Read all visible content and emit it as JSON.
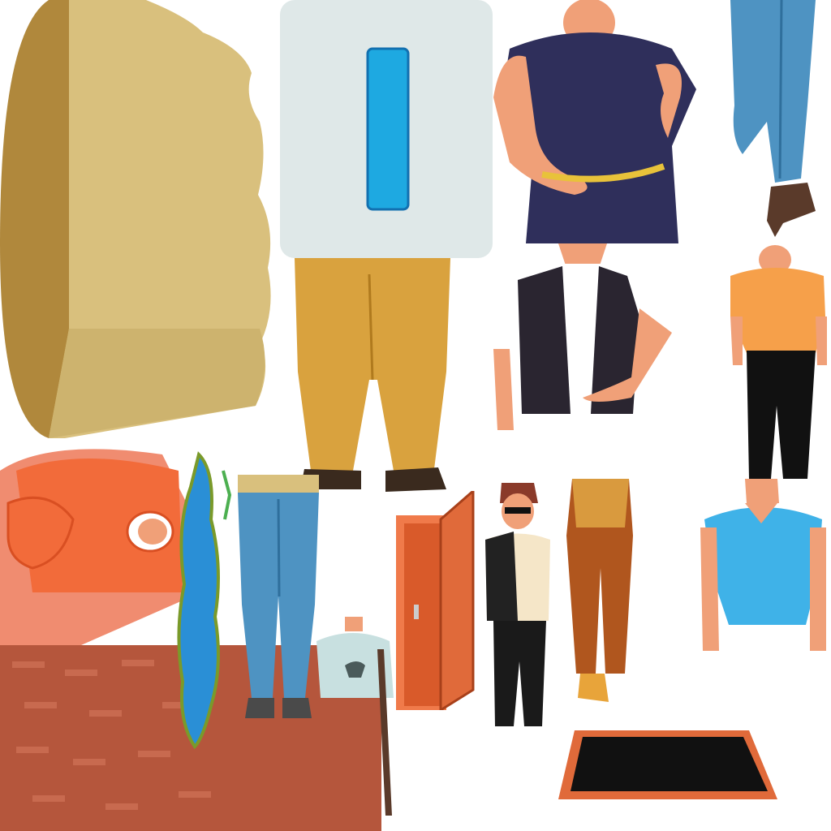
{
  "sheet": {
    "background_color": "#ffffff",
    "sprites": [
      {
        "name": "cardboard-box",
        "color": "#d9c07d"
      },
      {
        "name": "milk-carton",
        "color": "#dfe8e8",
        "accent": "#1ea9e1"
      },
      {
        "name": "chubby-man-navy-shirt",
        "color": "#2f2f5b"
      },
      {
        "name": "blue-jeans-legs",
        "color": "#4e93c2"
      },
      {
        "name": "mustard-trousers-legs",
        "color": "#d9a23e"
      },
      {
        "name": "man-black-vest",
        "color": "#2a2530"
      },
      {
        "name": "man-orange-shirt",
        "color": "#f6a04a"
      },
      {
        "name": "man-blue-shirt-torso",
        "color": "#3fb2e8"
      },
      {
        "name": "man-orange-hoodie-back",
        "color": "#f26b3a"
      },
      {
        "name": "brick-wall",
        "color": "#b5563c"
      },
      {
        "name": "water-puddle",
        "color": "#2a8fd6"
      },
      {
        "name": "second-jeans-legs",
        "color": "#4e93c2"
      },
      {
        "name": "man-light-blue-shirt-with-cane",
        "color": "#c8e0e0"
      },
      {
        "name": "open-door",
        "color": "#e06a3a"
      },
      {
        "name": "agent-in-sunglasses",
        "color": "#222222"
      },
      {
        "name": "brown-trousers-legs",
        "color": "#b0561e"
      },
      {
        "name": "open-trapdoor",
        "color": "#e06a3a"
      }
    ]
  }
}
